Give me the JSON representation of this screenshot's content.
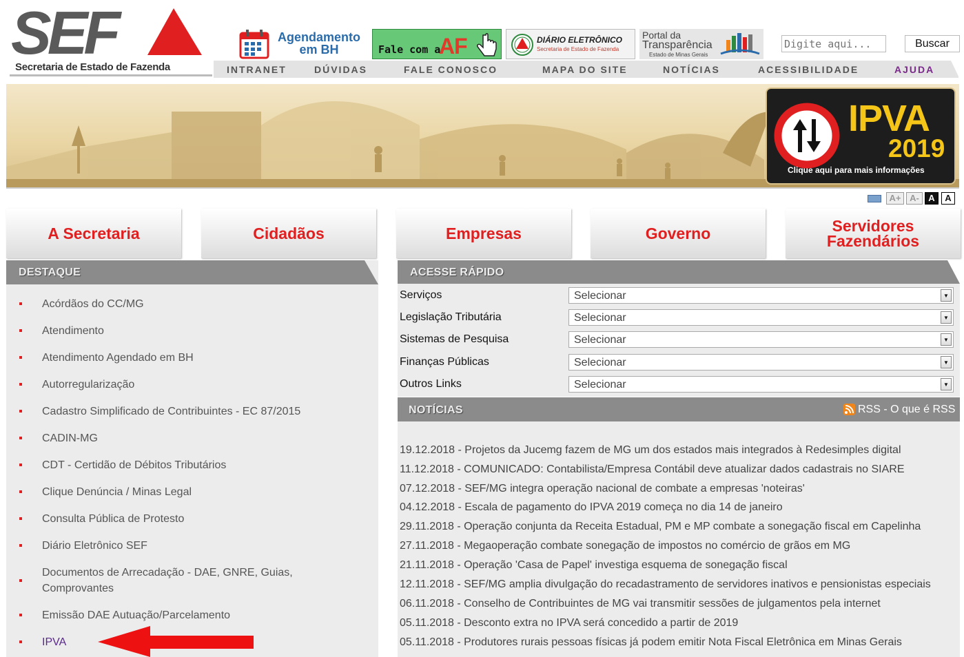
{
  "header": {
    "logo_text": "SEF",
    "logo_subtitle": "Secretaria de Estado de Fazenda",
    "promos": {
      "agenda": "Agendamento em BH",
      "af_prefix": "Fale com a",
      "af_big": "AF",
      "diario_title": "DIÁRIO ELETRÔNICO",
      "diario_sub": "Secretaria de Estado de Fazenda",
      "portal_1": "Portal da",
      "portal_2": "Transparência",
      "portal_3": "Estado de Minas Gerais"
    },
    "search": {
      "placeholder": "Digite aqui...",
      "button": "Buscar"
    }
  },
  "topnav": [
    "INTRANET",
    "DÚVIDAS",
    "FALE CONOSCO",
    "MAPA DO SITE",
    "NOTÍCIAS",
    "ACESSIBILIDADE",
    "AJUDA"
  ],
  "banner": {
    "ipva_title": "IPVA",
    "ipva_year": "2019",
    "ipva_caption": "Clique aqui para mais informações"
  },
  "font_tools": [
    "A+",
    "A-",
    "A",
    "A"
  ],
  "bignav": [
    "A Secretaria",
    "Cidadãos",
    "Empresas",
    "Governo",
    "Servidores Fazendários"
  ],
  "destaque": {
    "title": "DESTAQUE",
    "items": [
      "Acórdãos do CC/MG",
      "Atendimento",
      "Atendimento Agendado em BH",
      "Autorregularização",
      "Cadastro Simplificado de Contribuintes - EC 87/2015",
      "CADIN-MG",
      "CDT - Certidão de Débitos Tributários",
      "Clique Denúncia / Minas Legal",
      "Consulta Pública de Protesto",
      "Diário Eletrônico SEF",
      "Documentos de Arrecadação - DAE, GNRE, Guias, Comprovantes",
      "Emissão DAE Autuação/Parcelamento",
      "IPVA"
    ]
  },
  "acesse": {
    "title": "ACESSE RÁPIDO",
    "rows": [
      {
        "label": "Serviços",
        "value": "Selecionar"
      },
      {
        "label": "Legislação Tributária",
        "value": "Selecionar"
      },
      {
        "label": "Sistemas de Pesquisa",
        "value": "Selecionar"
      },
      {
        "label": "Finanças Públicas",
        "value": "Selecionar"
      },
      {
        "label": "Outros Links",
        "value": "Selecionar"
      }
    ]
  },
  "noticias": {
    "title": "NOTÍCIAS",
    "rss": "RSS - O que é RSS",
    "items": [
      "19.12.2018 - Projetos da Jucemg fazem de MG um dos estados mais integrados à Redesimples digital",
      "11.12.2018 - COMUNICADO: Contabilista/Empresa Contábil deve atualizar dados cadastrais no SIARE",
      "07.12.2018 - SEF/MG integra operação nacional de combate a empresas 'noteiras'",
      "04.12.2018 - Escala de pagamento do IPVA 2019 começa no dia 14 de janeiro",
      "29.11.2018 - Operação conjunta da Receita Estadual, PM e MP combate a sonegação fiscal em Capelinha",
      "27.11.2018 - Megaoperação combate sonegação de impostos no comércio de grãos em MG",
      "21.11.2018 - Operação 'Casa de Papel' investiga esquema de sonegação fiscal",
      "12.11.2018 - SEF/MG amplia divulgação do recadastramento de servidores inativos e pensionistas especiais",
      "06.11.2018 - Conselho de Contribuintes de MG vai transmitir sessões de julgamentos pela internet",
      "05.11.2018 - Desconto extra no IPVA será concedido a partir de 2019",
      "05.11.2018 - Produtores rurais pessoas físicas já podem emitir Nota Fiscal Eletrônica em Minas Gerais"
    ]
  },
  "colors": {
    "accent_red": "#e02020",
    "section_gray": "#8b8b8b",
    "panel_gray": "#ececec",
    "ipva_yellow": "#f5c518"
  }
}
